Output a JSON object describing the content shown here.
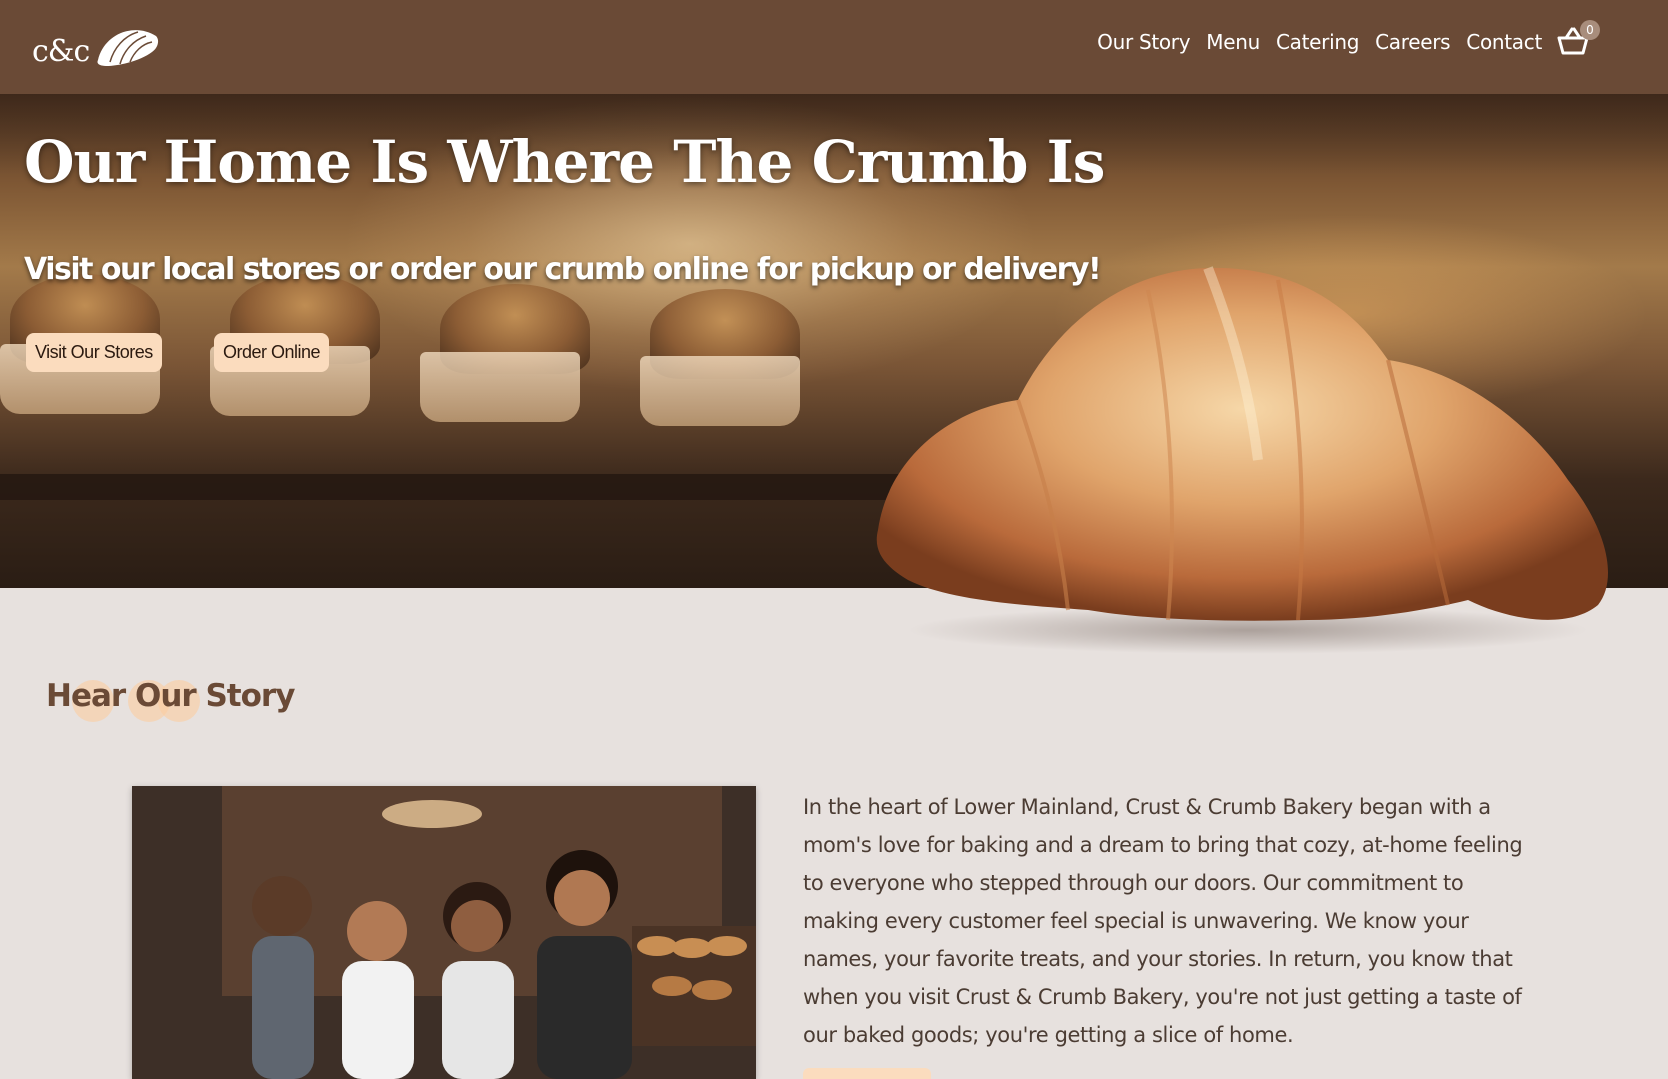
{
  "header": {
    "logo_text": "c&c",
    "nav": [
      "Our Story",
      "Menu",
      "Catering",
      "Careers",
      "Contact"
    ],
    "cart_count": "0"
  },
  "hero": {
    "title": "Our Home Is Where The Crumb Is",
    "subtitle": "Visit our local stores or order our crumb online for pickup or delivery!",
    "buttons": [
      "Visit Our Stores",
      "Order Online"
    ]
  },
  "story": {
    "title": "Hear Our Story",
    "body": "In the heart of Lower Mainland, Crust & Crumb Bakery began with a mom's love for baking and a dream to bring that cozy, at-home feeling to everyone who stepped through our doors. Our commitment to making every customer feel special is unwavering. We know your names, your favorite treats, and your stories. In return, you know that when you visit Crust & Crumb Bakery, you're not just getting a taste of our baked goods; you're getting a slice of home."
  },
  "colors": {
    "header_bg": "#6a4a36",
    "accent": "#fbdcbe",
    "page_bg": "#e7e1de",
    "text": "#4b3c33"
  }
}
